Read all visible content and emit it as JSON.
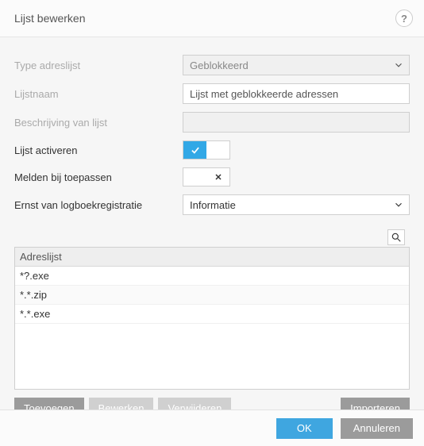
{
  "header": {
    "title": "Lijst bewerken"
  },
  "form": {
    "typeLabel": "Type adreslijst",
    "typeValue": "Geblokkeerd",
    "nameLabel": "Lijstnaam",
    "nameValue": "Lijst met geblokkeerde adressen",
    "descLabel": "Beschrijving van lijst",
    "descValue": "",
    "activateLabel": "Lijst activeren",
    "activateOn": true,
    "notifyLabel": "Melden bij toepassen",
    "notifyOn": false,
    "severityLabel": "Ernst van logboekregistratie",
    "severityValue": "Informatie"
  },
  "list": {
    "header": "Adreslijst",
    "items": [
      "*?.exe",
      "*.*.zip",
      "*.*.exe"
    ]
  },
  "buttons": {
    "add": "Toevoegen",
    "edit": "Bewerken",
    "delete": "Verwijderen",
    "import": "Importeren",
    "ok": "OK",
    "cancel": "Annuleren"
  }
}
